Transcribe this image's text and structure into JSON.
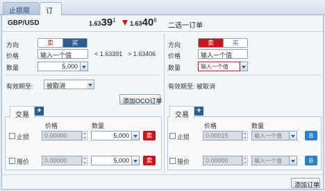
{
  "tabs": {
    "stop_loss_limit": "止损限价",
    "order": "订单"
  },
  "quote": {
    "pair": "GBP/USD",
    "bid": {
      "prefix": "1.63",
      "big": "39",
      "sup": "1"
    },
    "ask": {
      "prefix": "1.63",
      "big": "40",
      "sup": "6"
    },
    "direction_color": "#c4161c"
  },
  "oco_title": "二选一订单",
  "left": {
    "direction_label": "方向",
    "sell": "卖",
    "buy": "买",
    "price_label": "价格",
    "price_placeholder": "输入一个值",
    "range_low": "< 1.63391",
    "range_high": "> 1.63406",
    "qty_label": "数量",
    "qty_value": "5,000",
    "validity_label": "有效期至:",
    "validity_value": "被取消",
    "add_oco": "添加OCO订单",
    "subtab": "交易",
    "col_price": "价格",
    "col_qty": "数量",
    "rows": [
      {
        "label": "止损",
        "price": "0.00000",
        "qty": "5,000",
        "side": "卖"
      },
      {
        "label": "限价",
        "price": "0.00000",
        "qty": "5,000",
        "side": "卖"
      }
    ]
  },
  "right": {
    "direction_label": "方向",
    "sell": "卖",
    "buy": "买",
    "price_label": "价格",
    "price_placeholder": "输入一个值",
    "qty_label": "数量",
    "qty_placeholder": "输入一个值",
    "validity_text": "有效期至: 被取消",
    "subtab": "交易",
    "col_price": "价格",
    "col_qty": "数量",
    "rows": [
      {
        "label": "止损",
        "price": "0.00015",
        "qty": "输入一个值",
        "side": "B"
      },
      {
        "label": "限价",
        "price": "0.00000",
        "qty": "输入一个值",
        "side": "B"
      }
    ]
  },
  "footer": {
    "add_order": "添加订单"
  },
  "colors": {
    "sell_red": "#c4161c",
    "buy_blue": "#2c5f91",
    "side_blue": "#2c7fc8"
  }
}
